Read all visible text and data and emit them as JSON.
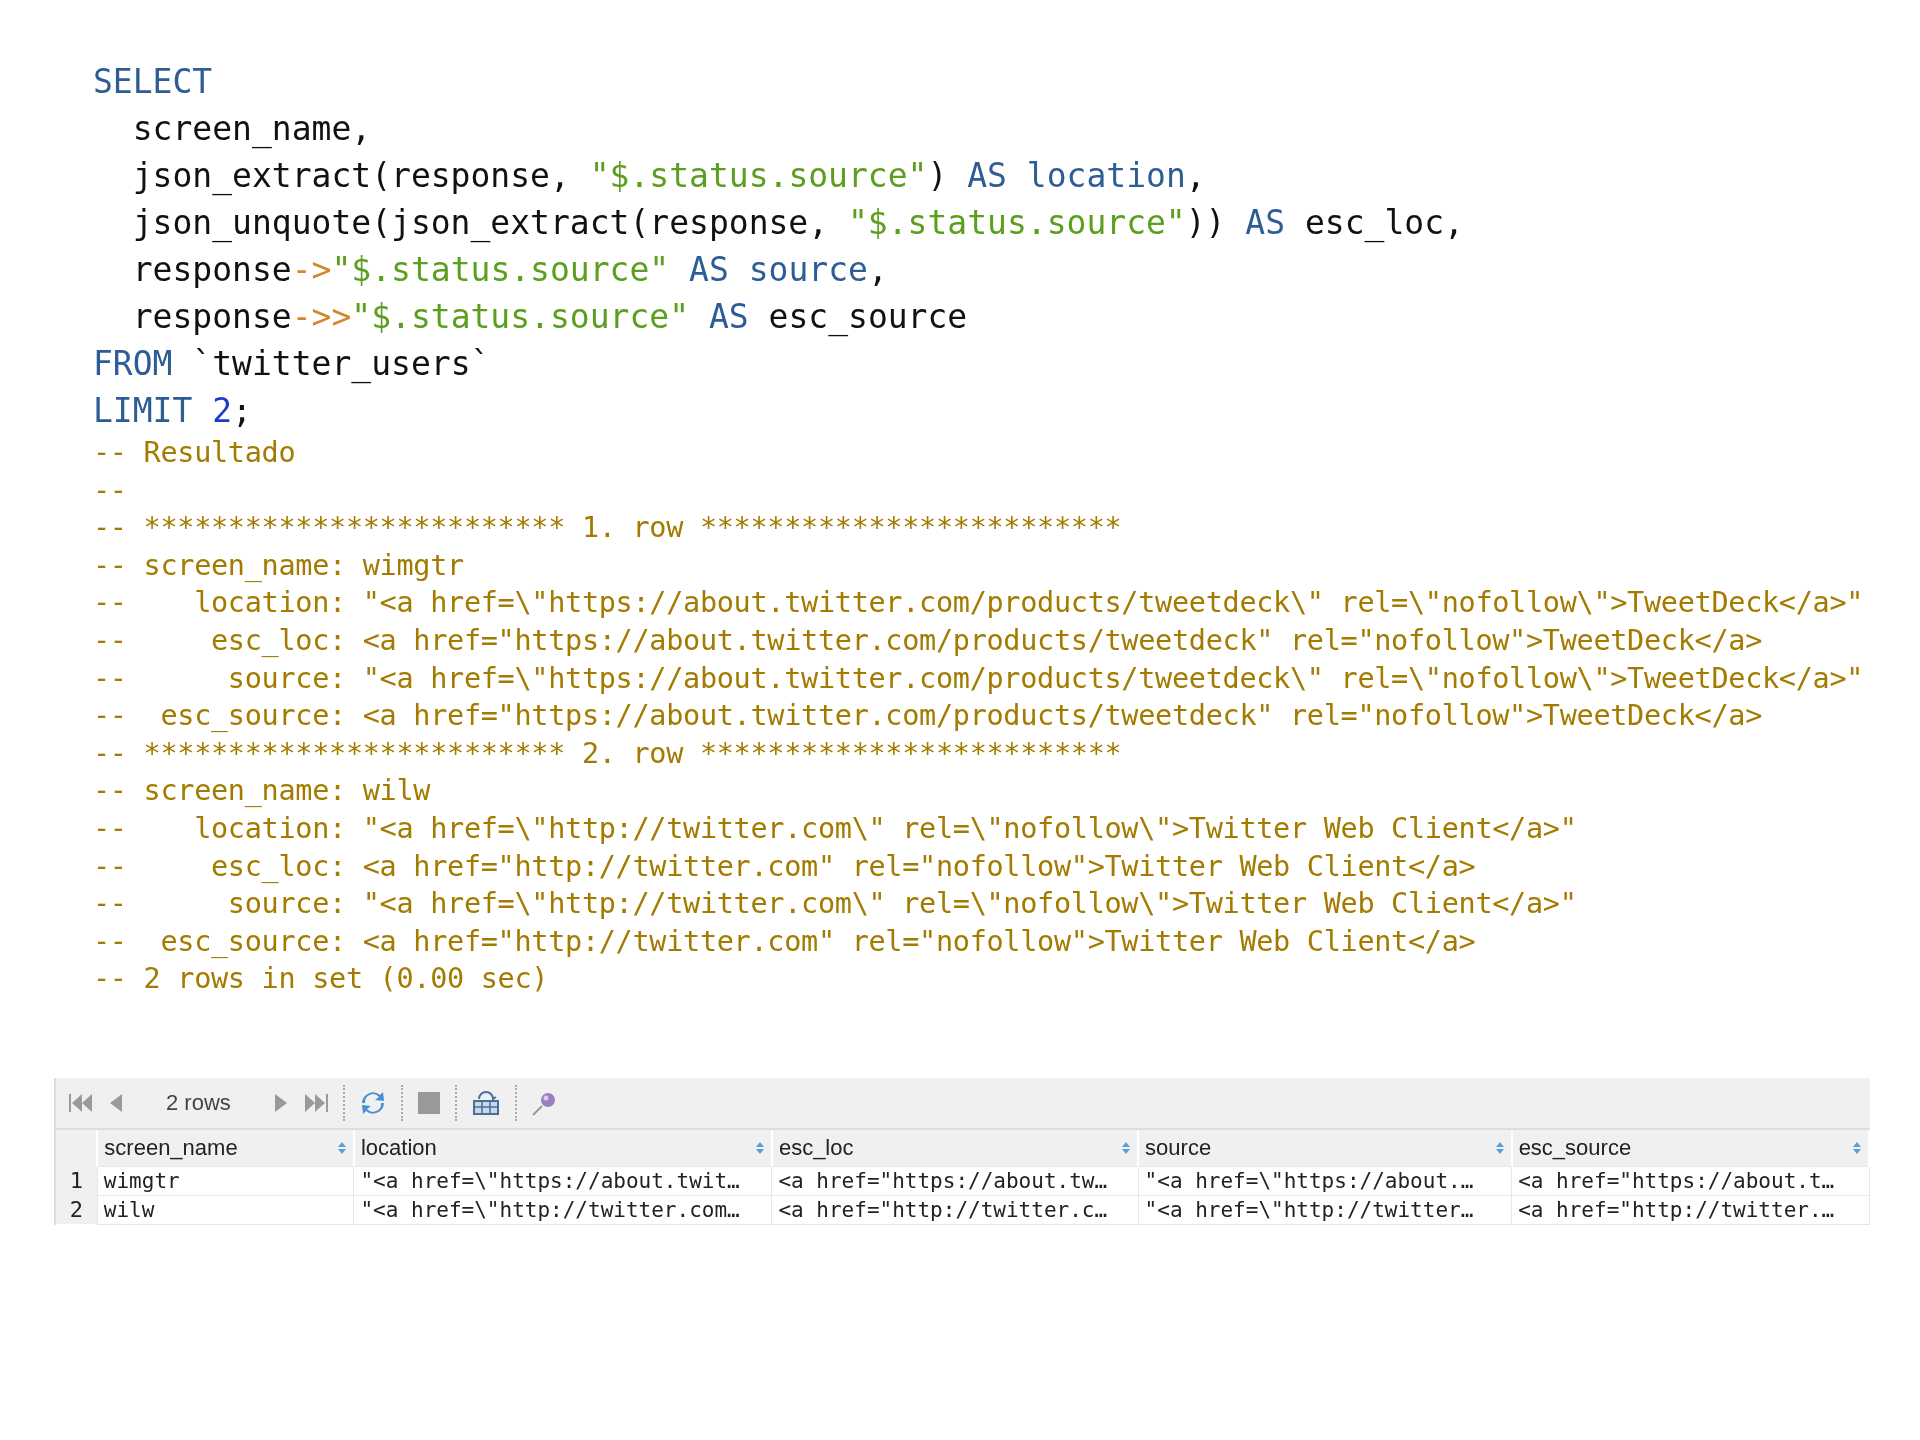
{
  "editor": {
    "lines": [
      {
        "kind": "code",
        "tokens": [
          {
            "kind": "keyword",
            "text": "SELECT"
          }
        ]
      },
      {
        "kind": "code",
        "tokens": [
          {
            "kind": "plain",
            "text": "  screen_name,"
          }
        ]
      },
      {
        "kind": "code",
        "tokens": [
          {
            "kind": "plain",
            "text": "  json_extract(response, "
          },
          {
            "kind": "string",
            "text": "\"$.status.source\""
          },
          {
            "kind": "plain",
            "text": ") "
          },
          {
            "kind": "keyword",
            "text": "AS location"
          },
          {
            "kind": "plain",
            "text": ","
          }
        ]
      },
      {
        "kind": "code",
        "tokens": [
          {
            "kind": "plain",
            "text": "  json_unquote(json_extract(response, "
          },
          {
            "kind": "string",
            "text": "\"$.status.source\""
          },
          {
            "kind": "plain",
            "text": ")) "
          },
          {
            "kind": "keyword",
            "text": "AS"
          },
          {
            "kind": "plain",
            "text": " esc_loc,"
          }
        ]
      },
      {
        "kind": "code",
        "tokens": [
          {
            "kind": "plain",
            "text": "  response"
          },
          {
            "kind": "operator",
            "text": "->"
          },
          {
            "kind": "string",
            "text": "\"$.status.source\""
          },
          {
            "kind": "keyword",
            "text": " AS source"
          },
          {
            "kind": "plain",
            "text": ","
          }
        ]
      },
      {
        "kind": "code",
        "tokens": [
          {
            "kind": "plain",
            "text": "  response"
          },
          {
            "kind": "operator",
            "text": "->>"
          },
          {
            "kind": "string",
            "text": "\"$.status.source\""
          },
          {
            "kind": "keyword",
            "text": " AS"
          },
          {
            "kind": "plain",
            "text": " esc_source"
          }
        ]
      },
      {
        "kind": "code",
        "tokens": [
          {
            "kind": "keyword",
            "text": "FROM"
          },
          {
            "kind": "plain",
            "text": " `twitter_users`"
          }
        ]
      },
      {
        "kind": "code",
        "tokens": [
          {
            "kind": "keyword",
            "text": "LIMIT "
          },
          {
            "kind": "number",
            "text": "2"
          },
          {
            "kind": "plain",
            "text": ";"
          }
        ]
      },
      {
        "kind": "comment",
        "text": "-- Resultado"
      },
      {
        "kind": "comment",
        "text": "--"
      },
      {
        "kind": "comment",
        "text": "-- ************************* 1. row *************************"
      },
      {
        "kind": "comment",
        "text": "-- screen_name: wimgtr"
      },
      {
        "kind": "comment",
        "text": "--    location: \"<a href=\\\"https://about.twitter.com/products/tweetdeck\\\" rel=\\\"nofollow\\\">TweetDeck</a>\""
      },
      {
        "kind": "comment",
        "text": "--     esc_loc: <a href=\"https://about.twitter.com/products/tweetdeck\" rel=\"nofollow\">TweetDeck</a>"
      },
      {
        "kind": "comment",
        "text": "--      source: \"<a href=\\\"https://about.twitter.com/products/tweetdeck\\\" rel=\\\"nofollow\\\">TweetDeck</a>\""
      },
      {
        "kind": "comment",
        "text": "--  esc_source: <a href=\"https://about.twitter.com/products/tweetdeck\" rel=\"nofollow\">TweetDeck</a>"
      },
      {
        "kind": "comment",
        "text": "-- ************************* 2. row *************************"
      },
      {
        "kind": "comment",
        "text": "-- screen_name: wilw"
      },
      {
        "kind": "comment",
        "text": "--    location: \"<a href=\\\"http://twitter.com\\\" rel=\\\"nofollow\\\">Twitter Web Client</a>\""
      },
      {
        "kind": "comment",
        "text": "--     esc_loc: <a href=\"http://twitter.com\" rel=\"nofollow\">Twitter Web Client</a>"
      },
      {
        "kind": "comment",
        "text": "--      source: \"<a href=\\\"http://twitter.com\\\" rel=\\\"nofollow\\\">Twitter Web Client</a>\""
      },
      {
        "kind": "comment",
        "text": "--  esc_source: <a href=\"http://twitter.com\" rel=\"nofollow\">Twitter Web Client</a>"
      },
      {
        "kind": "comment",
        "text": "-- 2 rows in set (0.00 sec)"
      }
    ]
  },
  "results": {
    "toolbar": {
      "row_count": "2 rows"
    },
    "columns": [
      "screen_name",
      "location",
      "esc_loc",
      "source",
      "esc_source"
    ],
    "rows": [
      {
        "number": "1",
        "cells": [
          "wimgtr",
          "\"<a href=\\\"https://about.twit…",
          "<a href=\"https://about.tw…",
          "\"<a href=\\\"https://about.…",
          "<a href=\"https://about.t…"
        ]
      },
      {
        "number": "2",
        "cells": [
          "wilw",
          "\"<a href=\\\"http://twitter.com…",
          "<a href=\"http://twitter.c…",
          "\"<a href=\\\"http://twitter…",
          "<a href=\"http://twitter.…"
        ]
      }
    ]
  }
}
